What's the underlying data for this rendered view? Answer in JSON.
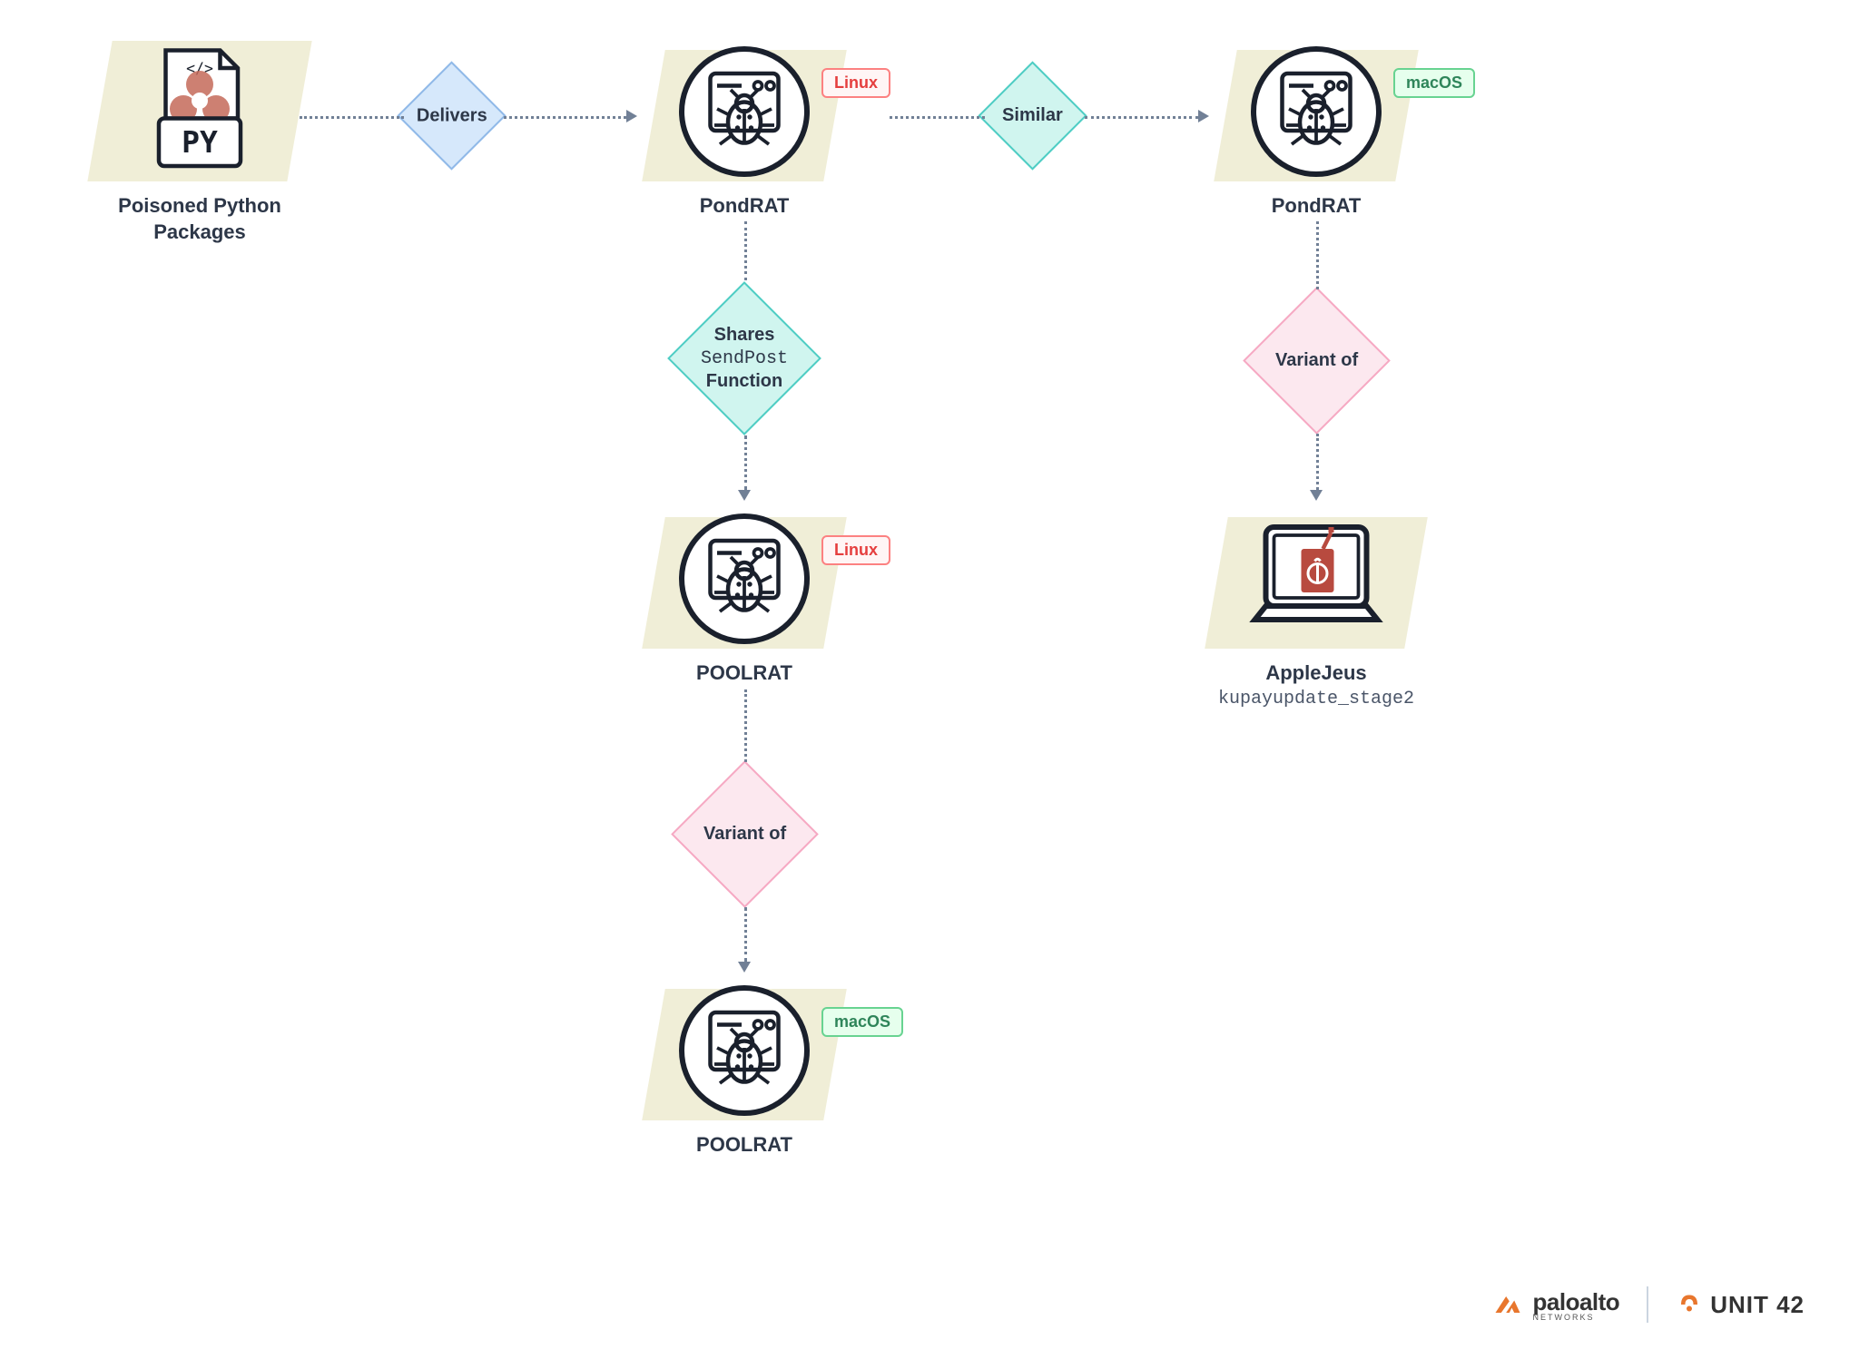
{
  "nodes": {
    "poisoned": {
      "label": "Poisoned Python\nPackages"
    },
    "pondrat_linux": {
      "label": "PondRAT",
      "tag": "Linux"
    },
    "pondrat_macos": {
      "label": "PondRAT",
      "tag": "macOS"
    },
    "poolrat_linux": {
      "label": "POOLRAT",
      "tag": "Linux"
    },
    "poolrat_macos": {
      "label": "POOLRAT",
      "tag": "macOS"
    },
    "applejeus": {
      "label": "AppleJeus",
      "sublabel": "kupayupdate_stage2"
    }
  },
  "diamonds": {
    "delivers": "Delivers",
    "similar": "Similar",
    "shares_l1": "Shares",
    "shares_l2": "SendPost",
    "shares_l3": "Function",
    "variant1": "Variant of",
    "variant2": "Variant of"
  },
  "tags": {
    "linux": "Linux",
    "macos": "macOS"
  },
  "footer": {
    "paloalto": "paloalto",
    "paloalto_sub": "NETWORKS",
    "unit42": "UNIT 42"
  }
}
